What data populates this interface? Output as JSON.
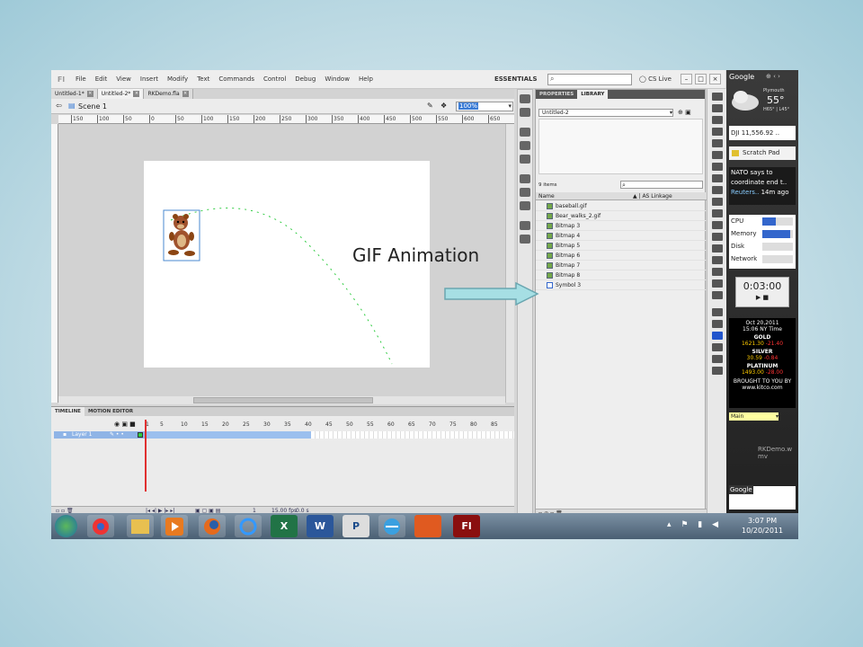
{
  "menubar": {
    "items": [
      "File",
      "Edit",
      "View",
      "Insert",
      "Modify",
      "Text",
      "Commands",
      "Control",
      "Debug",
      "Window",
      "Help"
    ],
    "workspace": "ESSENTIALS",
    "cs_live": "CS Live"
  },
  "doc_tabs": [
    {
      "label": "Untitled-1*"
    },
    {
      "label": "Untitled-2*"
    },
    {
      "label": "RKDemo.fla"
    }
  ],
  "scene": {
    "label": "Scene 1",
    "zoom": "100%"
  },
  "ruler": [
    "150",
    "100",
    "50",
    "0",
    "50",
    "100",
    "150",
    "200",
    "250",
    "300",
    "350",
    "400",
    "450",
    "500",
    "550",
    "600",
    "650"
  ],
  "timeline": {
    "tabs": [
      "TIMELINE",
      "MOTION EDITOR"
    ],
    "frames": [
      "1",
      "5",
      "10",
      "15",
      "20",
      "25",
      "30",
      "35",
      "40",
      "45",
      "50",
      "55",
      "60",
      "65",
      "70",
      "75",
      "80",
      "85"
    ],
    "layer": "Layer 1",
    "current_frame": "1",
    "fps": "15.00 fps",
    "time": "0.0 s"
  },
  "panel": {
    "tabs": [
      "PROPERTIES",
      "LIBRARY"
    ],
    "library_select": "Untitled-2",
    "item_count": "9 items",
    "columns": {
      "name": "Name",
      "linkage": "AS Linkage"
    },
    "items": [
      "baseball.gif",
      "Bear_walks_2.gif",
      "Bitmap 3",
      "Bitmap 4",
      "Bitmap 5",
      "Bitmap 6",
      "Bitmap 7",
      "Bitmap 8",
      "Symbol 3"
    ]
  },
  "sidebar": {
    "title": "Google",
    "weather": {
      "city": "Plymouth",
      "temp": "55°",
      "range": "H65° | L45°"
    },
    "stock": "DJI 11,556.92 ..",
    "scratch": "Scratch Pad",
    "news": {
      "l1": "NATO says to",
      "l2": "coordinate end t..",
      "src": "Reuters..",
      "age": "14m ago"
    },
    "meters": [
      {
        "label": "CPU",
        "level": 0.45
      },
      {
        "label": "Memory",
        "level": 0.9
      },
      {
        "label": "Disk",
        "level": 0
      },
      {
        "label": "Network",
        "level": 0
      }
    ],
    "timer": "0:03:00",
    "metals": {
      "date": "Oct 20,2011",
      "time": "15:06 NY Time",
      "gold": {
        "name": "GOLD",
        "price": "1621.30",
        "change": "-21.40"
      },
      "silver": {
        "name": "SILVER",
        "price": "30.59",
        "change": "-0.84"
      },
      "platinum": {
        "name": "PLATINUM",
        "price": "1493.00",
        "change": "-28.00"
      },
      "credit1": "BROUGHT TO YOU BY",
      "credit2": "www.kitco.com"
    },
    "main_select": "Main",
    "search_label": "Google"
  },
  "desktop_icon": "RKDemo.w\nmv",
  "taskbar": {
    "icons": [
      "chrome-icon",
      "explorer-icon",
      "media-icon",
      "firefox-icon",
      "ie-icon",
      "excel-icon",
      "word-icon",
      "publisher-icon",
      "browser-icon",
      "app-icon",
      "flash-icon"
    ],
    "labels": {
      "excel": "X",
      "word": "W",
      "publisher": "P",
      "flash": "Fl"
    },
    "time": "3:07 PM",
    "date": "10/20/2011"
  },
  "annotation": "GIF Animation"
}
